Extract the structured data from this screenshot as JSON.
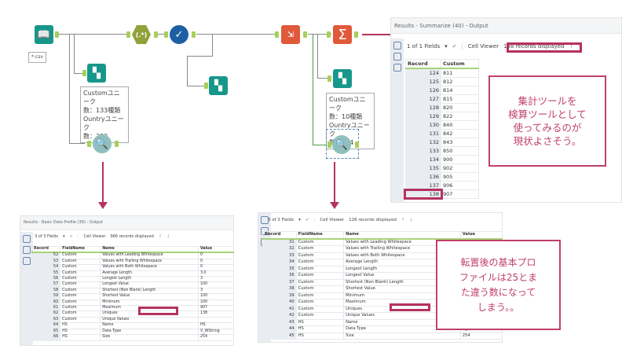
{
  "workflow": {
    "input_label": "*.csv",
    "comment_left": "Customユニーク\n数：133種類\nOuntryユニーク\n数：222",
    "comment_right": "Customユニーク\n数：10種類\nOuntryユニーク\n数：214",
    "regex_glyph": "(.*)",
    "summarize_glyph": "Σ",
    "colors": {
      "teal": "#17978a",
      "olive": "#8fa23b",
      "blue": "#1e5fa3",
      "orange": "#e0593a",
      "anchor": "#a7cf5a",
      "annotation": "#b5325f"
    }
  },
  "summarize_panel": {
    "title": "Results - Summarize (40) - Output",
    "fields": "1 of 1 Fields",
    "cell_viewer": "Cell Viewer",
    "records": "138 records displayed",
    "columns": [
      "Record",
      "Custom"
    ],
    "rows": [
      [
        "124",
        "811"
      ],
      [
        "125",
        "812"
      ],
      [
        "126",
        "814"
      ],
      [
        "127",
        "815"
      ],
      [
        "128",
        "820"
      ],
      [
        "129",
        "822"
      ],
      [
        "130",
        "840"
      ],
      [
        "131",
        "842"
      ],
      [
        "132",
        "843"
      ],
      [
        "133",
        "850"
      ],
      [
        "134",
        "900"
      ],
      [
        "135",
        "902"
      ],
      [
        "136",
        "905"
      ],
      [
        "137",
        "906"
      ],
      [
        "138",
        "907"
      ]
    ],
    "note": "集計ツールを\n検算ツールとして\n使ってみるのが\n現状よさそう。"
  },
  "profile_panel": {
    "title": "Results - Basic Data Profile (39) - Output",
    "fields": "3 of 3 Fields",
    "cell_viewer": "Cell Viewer",
    "records": "966 records displayed",
    "columns": [
      "Record",
      "FieldName",
      "Name",
      "Value"
    ],
    "rows": [
      [
        "52",
        "Custom",
        "Values with Leading Whitespace",
        "0"
      ],
      [
        "53",
        "Custom",
        "Values with Trailing Whitespace",
        "0"
      ],
      [
        "54",
        "Custom",
        "Values with Both Whitespace",
        "0"
      ],
      [
        "55",
        "Custom",
        "Average Length",
        "3.0"
      ],
      [
        "56",
        "Custom",
        "Longest Length",
        "3"
      ],
      [
        "57",
        "Custom",
        "Longest Value",
        "100"
      ],
      [
        "58",
        "Custom",
        "Shortest (Non Blank) Length",
        "3"
      ],
      [
        "59",
        "Custom",
        "Shortest Value",
        "100"
      ],
      [
        "60",
        "Custom",
        "Minimum",
        "100"
      ],
      [
        "61",
        "Custom",
        "Maximum",
        "907"
      ],
      [
        "62",
        "Custom",
        "Uniques",
        "138"
      ],
      [
        "63",
        "Custom",
        "Unique Values",
        ""
      ],
      [
        "64",
        "HS",
        "Name",
        "HS"
      ],
      [
        "65",
        "HS",
        "Data Type",
        "V_WString"
      ],
      [
        "66",
        "HS",
        "Size",
        "254"
      ]
    ]
  },
  "transposed_panel": {
    "fields": "3 of 3 Fields",
    "cell_viewer": "Cell Viewer",
    "records": "126 records displayed",
    "columns": [
      "Record",
      "FieldName",
      "Name",
      "Value"
    ],
    "rows": [
      [
        "31",
        "Custom",
        "Values with Leading Whitespace",
        "0"
      ],
      [
        "32",
        "Custom",
        "Values with Trailing Whitespace",
        "0"
      ],
      [
        "33",
        "Custom",
        "Values with Both Whitespace",
        "0"
      ],
      [
        "34",
        "Custom",
        "Average Length",
        "3.0"
      ],
      [
        "35",
        "Custom",
        "Longest Length",
        "3"
      ],
      [
        "36",
        "Custom",
        "Longest Value",
        "100"
      ],
      [
        "37",
        "Custom",
        "Shortest (Non Blank) Length",
        "3"
      ],
      [
        "38",
        "Custom",
        "Shortest Value",
        "100"
      ],
      [
        "39",
        "Custom",
        "Minimum",
        "100"
      ],
      [
        "40",
        "Custom",
        "Maximum",
        "300"
      ],
      [
        "41",
        "Custom",
        "Uniques",
        "25"
      ],
      [
        "42",
        "Custom",
        "Unique Values",
        "100"
      ],
      [
        "43",
        "HS",
        "Name",
        "HS"
      ],
      [
        "44",
        "HS",
        "Data Type",
        "V_WString"
      ],
      [
        "45",
        "HS",
        "Size",
        "254"
      ]
    ],
    "note": "転置後の基本プロ\nファイルは25とま\nた違う数になって\nしまう。。"
  }
}
